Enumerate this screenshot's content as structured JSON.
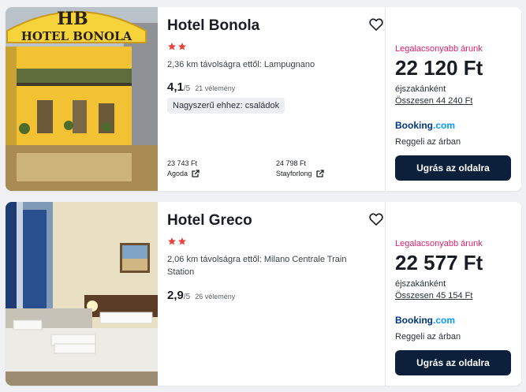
{
  "colors": {
    "accent_pink": "#e0206e",
    "cta_bg": "#0c1f3b",
    "star": "#e8453c",
    "booking_blue": "#003580"
  },
  "hotels": [
    {
      "name": "Hotel Bonola",
      "stars": 2,
      "photo_sign": "HOTEL BONOLA",
      "photo_logo": "HB",
      "distance": "2,36 km távolságra ettől: Lampugnano",
      "rating_score": "4,1",
      "rating_max": "/5",
      "rating_count": "21 vélemény",
      "badge": "Nagyszerű ehhez: családok",
      "alt_offers": [
        {
          "amount": "23 743 Ft",
          "site": "Agoda"
        },
        {
          "amount": "24 798 Ft",
          "site": "Stayforlong"
        }
      ],
      "price": {
        "lowest_label": "Legalacsonyabb árunk",
        "amount": "22 120 Ft",
        "per_night": "éjszakánként",
        "total": "Összesen 44 240 Ft",
        "provider_name": "Booking",
        "provider_suffix": ".com",
        "breakfast": "Reggeli az árban",
        "cta": "Ugrás az oldalra"
      }
    },
    {
      "name": "Hotel Greco",
      "stars": 2,
      "distance": "2,06 km távolságra ettől: Milano Centrale Train Station",
      "rating_score": "2,9",
      "rating_max": "/5",
      "rating_count": "26 vélemény",
      "price": {
        "lowest_label": "Legalacsonyabb árunk",
        "amount": "22 577 Ft",
        "per_night": "éjszakánként",
        "total": "Összesen 45 154 Ft",
        "provider_name": "Booking",
        "provider_suffix": ".com",
        "breakfast": "Reggeli az árban",
        "cta": "Ugrás az oldalra"
      }
    }
  ]
}
